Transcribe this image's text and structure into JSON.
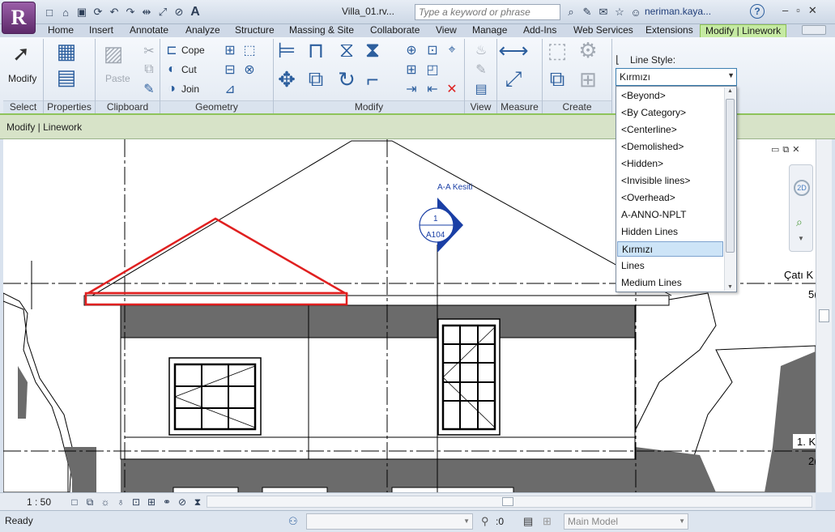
{
  "app": {
    "logo": "R",
    "doc_title": "Villa_01.rv...",
    "search_placeholder": "Type a keyword or phrase",
    "user": "neriman.kaya...",
    "help": "?"
  },
  "tabs": [
    "Home",
    "Insert",
    "Annotate",
    "Analyze",
    "Structure",
    "Massing & Site",
    "Collaborate",
    "View",
    "Manage",
    "Add-Ins",
    "Web Services",
    "Extensions",
    "Modify | Linework"
  ],
  "ribbon": {
    "panels": [
      "Select",
      "Properties",
      "Clipboard",
      "Geometry",
      "Modify",
      "View",
      "Measure",
      "Create"
    ],
    "modify_label": "Modify",
    "paste_label": "Paste",
    "cope_label": "Cope",
    "cut_label": "Cut",
    "join_label": "Join",
    "line_style_label": "Line Style:",
    "line_style_value": "Kırmızı"
  },
  "options_bar": {
    "title": "Modify | Linework"
  },
  "dropdown": {
    "items": [
      "<Beyond>",
      "<By Category>",
      "<Centerline>",
      "<Demolished>",
      "<Hidden>",
      "<Invisible lines>",
      "<Overhead>",
      "A-ANNO-NPLT",
      "Hidden Lines",
      "Kırmızı",
      "Lines",
      "Medium Lines"
    ],
    "selected": "Kırmızı"
  },
  "drawing": {
    "section_name": "A-A Kesiti",
    "section_number": "1",
    "sheet_number": "A104",
    "level_1": "Çatı K",
    "level_1_elev": "5(",
    "level_2": "1. K",
    "level_2_elev": "2("
  },
  "view_bar": {
    "scale": "1 : 50"
  },
  "status": {
    "text": "Ready",
    "zero": ":0",
    "model": "Main Model"
  }
}
